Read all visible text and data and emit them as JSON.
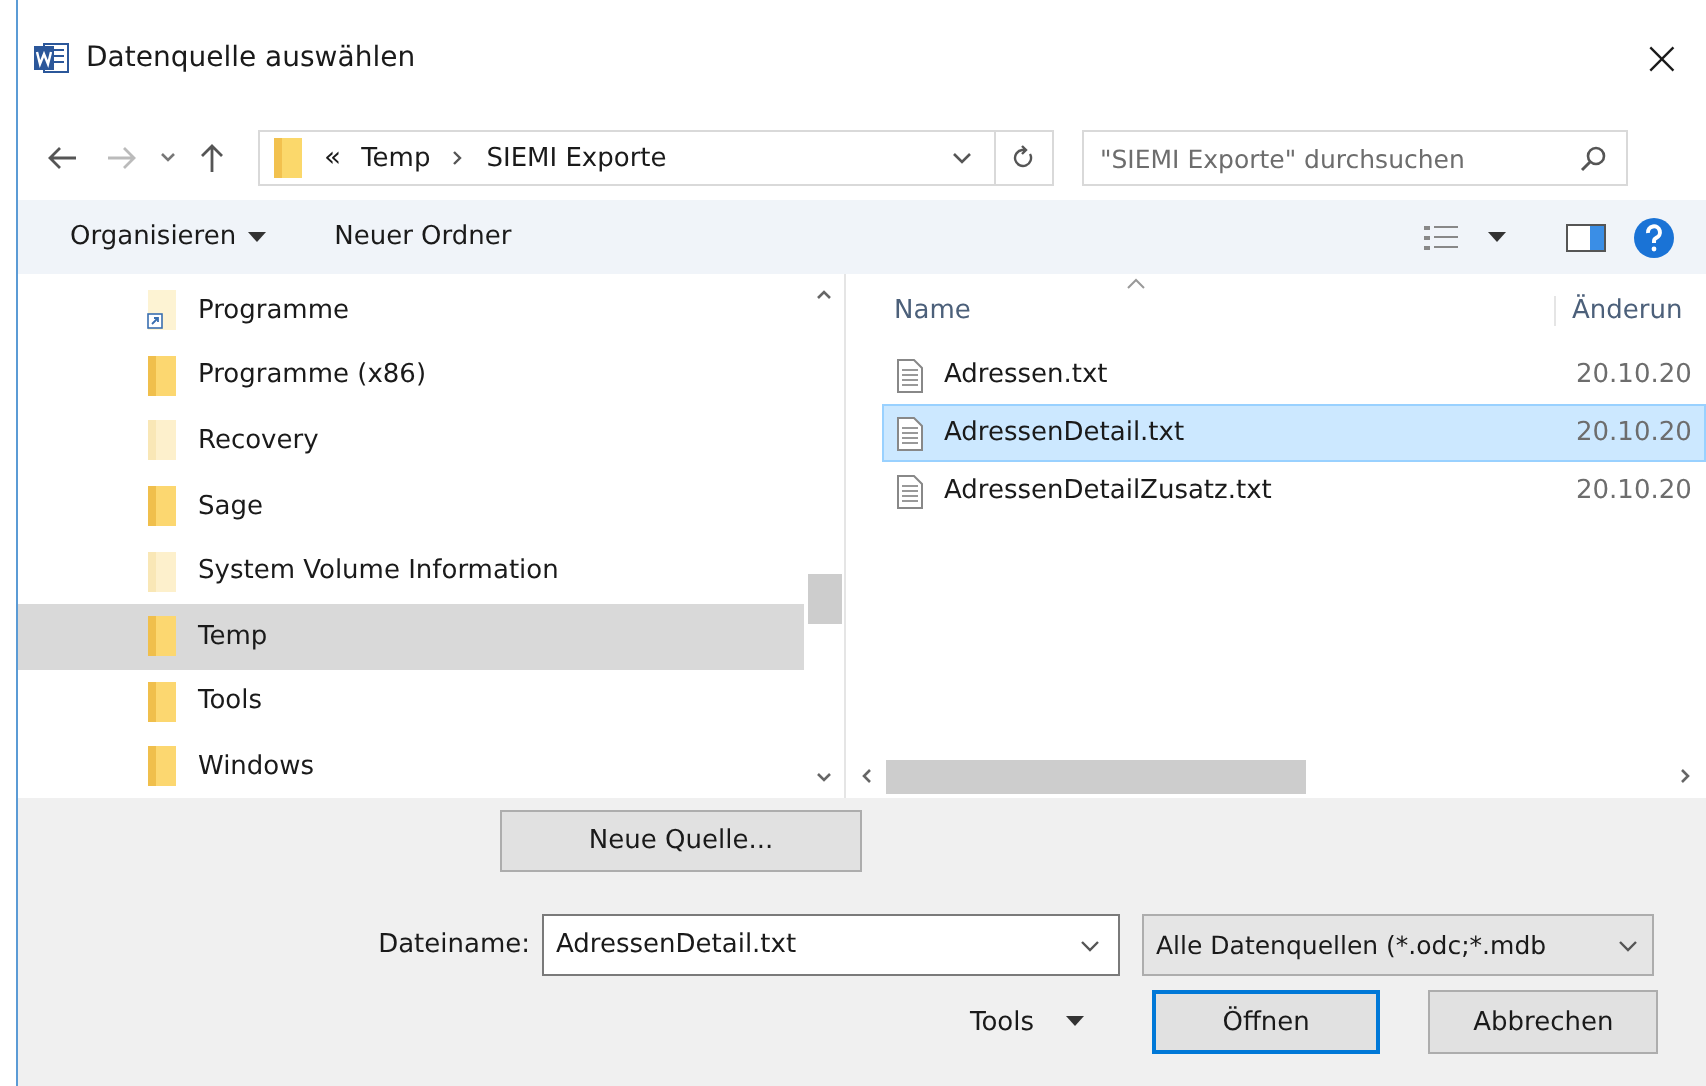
{
  "window": {
    "title": "Datenquelle auswählen",
    "close": "×"
  },
  "address": {
    "overflow": "«",
    "segments": [
      "Temp",
      "SIEMI Exporte"
    ]
  },
  "search": {
    "placeholder": "\"SIEMI Exporte\" durchsuchen"
  },
  "toolbar": {
    "organize": "Organisieren",
    "new_folder": "Neuer Ordner"
  },
  "tree": [
    {
      "label": "Programme",
      "kind": "shortcut",
      "selected": false
    },
    {
      "label": "Programme (x86)",
      "kind": "folder",
      "selected": false
    },
    {
      "label": "Recovery",
      "kind": "hidden",
      "selected": false
    },
    {
      "label": "Sage",
      "kind": "folder",
      "selected": false
    },
    {
      "label": "System Volume Information",
      "kind": "hidden",
      "selected": false
    },
    {
      "label": "Temp",
      "kind": "folder",
      "selected": true
    },
    {
      "label": "Tools",
      "kind": "folder",
      "selected": false
    },
    {
      "label": "Windows",
      "kind": "folder",
      "selected": false
    }
  ],
  "columns": [
    "Name",
    "Änderun"
  ],
  "files": [
    {
      "name": "Adressen.txt",
      "date": "20.10.20",
      "selected": false
    },
    {
      "name": "AdressenDetail.txt",
      "date": "20.10.20",
      "selected": true
    },
    {
      "name": "AdressenDetailZusatz.txt",
      "date": "20.10.20",
      "selected": false
    }
  ],
  "new_source_button": "Neue Quelle...",
  "filename": {
    "label": "Dateiname:",
    "value": "AdressenDetail.txt"
  },
  "filter": {
    "value": "Alle Datenquellen (*.odc;*.mdb"
  },
  "buttons": {
    "tools": "Tools",
    "open": "Öffnen",
    "cancel": "Abbrechen"
  }
}
